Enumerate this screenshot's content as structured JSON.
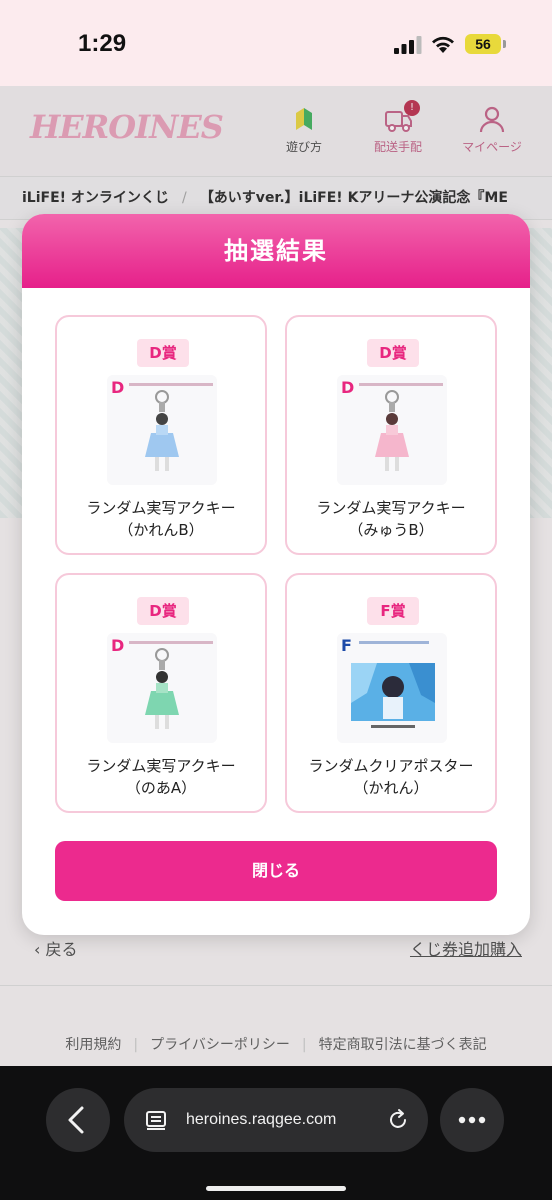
{
  "status_bar": {
    "time": "1:29",
    "battery": "56"
  },
  "site": {
    "logo": "HEROINES",
    "nav": [
      {
        "label": "遊び方",
        "icon": "beginner-mark-icon"
      },
      {
        "label": "配送手配",
        "icon": "truck-icon",
        "badge": "!"
      },
      {
        "label": "マイページ",
        "icon": "user-icon"
      }
    ]
  },
  "breadcrumb": [
    "iLiFE! オンラインくじ",
    "/",
    "【あいすver.】iLiFE! Kアリーナ公演記念『ME"
  ],
  "modal": {
    "title": "抽選結果",
    "prizes": [
      {
        "rank": "D賞",
        "name_line1": "ランダム実写アクキー",
        "name_line2": "（かれんB）"
      },
      {
        "rank": "D賞",
        "name_line1": "ランダム実写アクキー",
        "name_line2": "（みゅうB）"
      },
      {
        "rank": "D賞",
        "name_line1": "ランダム実写アクキー",
        "name_line2": "（のあA）"
      },
      {
        "rank": "F賞",
        "name_line1": "ランダムクリアポスター",
        "name_line2": "（かれん）"
      }
    ],
    "close_label": "閉じる"
  },
  "page": {
    "back_label": "戻る",
    "buy_more_label": "くじ券追加購入",
    "footer": [
      "利用規約",
      "プライバシーポリシー",
      "特定商取引法に基づく表記"
    ]
  },
  "browser": {
    "url": "heroines.raqgee.com"
  },
  "colors": {
    "accent": "#ec2a8e",
    "badge_bg": "#fde0ea",
    "card_border": "#f6c9da"
  }
}
